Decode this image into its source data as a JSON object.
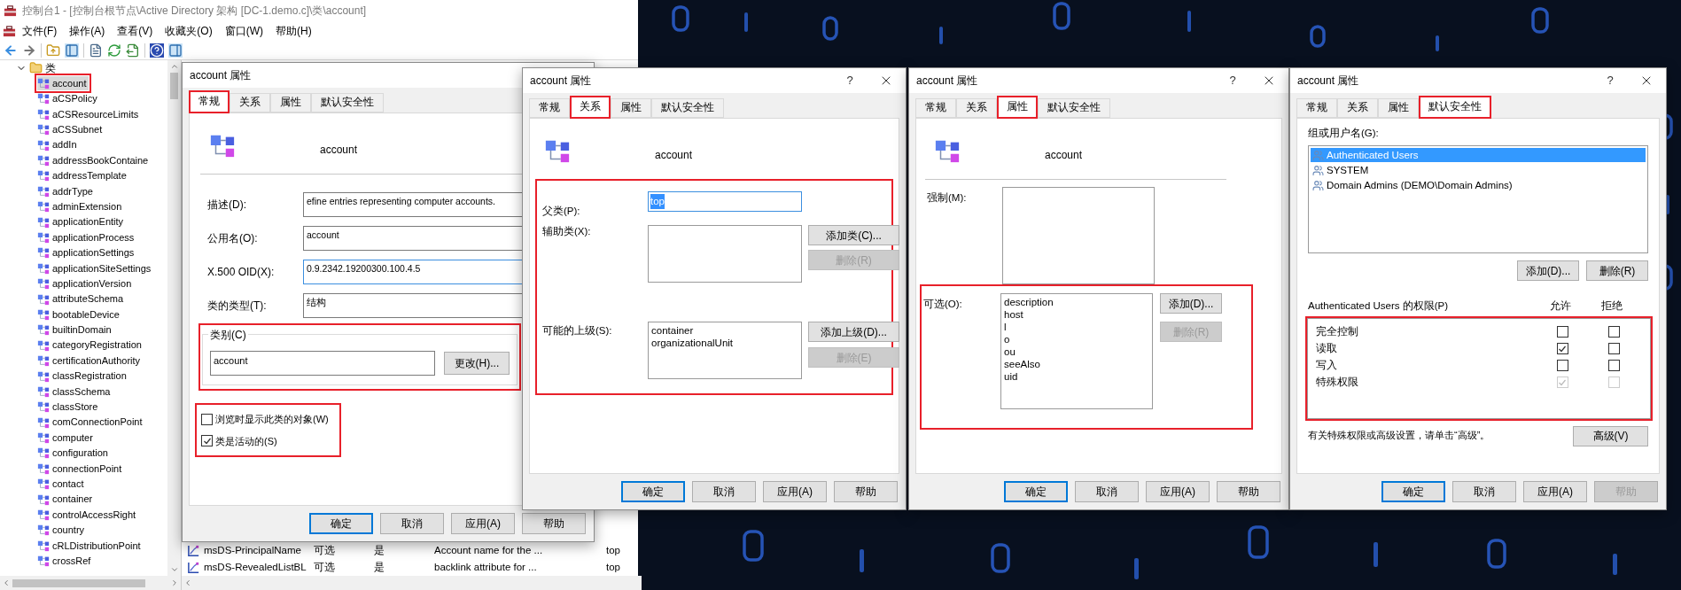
{
  "console": {
    "title": "控制台1 - [控制台根节点\\Active Directory 架构 [DC-1.demo.c]\\类\\account]",
    "menu": [
      "文件(F)",
      "操作(A)",
      "查看(V)",
      "收藏夹(O)",
      "窗口(W)",
      "帮助(H)"
    ],
    "tree": [
      {
        "label": "类",
        "expanded": true,
        "children": [
          {
            "label": "account",
            "selected": true,
            "highlighted": true
          },
          {
            "label": "aCSPolicy",
            "selected": false,
            "highlighted": false
          },
          {
            "label": "aCSResourceLimits",
            "selected": false,
            "highlighted": false
          },
          {
            "label": "aCSSubnet",
            "selected": false,
            "highlighted": false
          },
          {
            "label": "addIn",
            "selected": false,
            "highlighted": false
          },
          {
            "label": "addressBookContaine",
            "selected": false,
            "highlighted": false
          },
          {
            "label": "addressTemplate",
            "selected": false,
            "highlighted": false
          },
          {
            "label": "addrType",
            "selected": false,
            "highlighted": false
          },
          {
            "label": "adminExtension",
            "selected": false,
            "highlighted": false
          },
          {
            "label": "applicationEntity",
            "selected": false,
            "highlighted": false
          },
          {
            "label": "applicationProcess",
            "selected": false,
            "highlighted": false
          },
          {
            "label": "applicationSettings",
            "selected": false,
            "highlighted": false
          },
          {
            "label": "applicationSiteSettings",
            "selected": false,
            "highlighted": false
          },
          {
            "label": "applicationVersion",
            "selected": false,
            "highlighted": false
          },
          {
            "label": "attributeSchema",
            "selected": false,
            "highlighted": false
          },
          {
            "label": "bootableDevice",
            "selected": false,
            "highlighted": false
          },
          {
            "label": "builtinDomain",
            "selected": false,
            "highlighted": false
          },
          {
            "label": "categoryRegistration",
            "selected": false,
            "highlighted": false
          },
          {
            "label": "certificationAuthority",
            "selected": false,
            "highlighted": false
          },
          {
            "label": "classRegistration",
            "selected": false,
            "highlighted": false
          },
          {
            "label": "classSchema",
            "selected": false,
            "highlighted": false
          },
          {
            "label": "classStore",
            "selected": false,
            "highlighted": false
          },
          {
            "label": "comConnectionPoint",
            "selected": false,
            "highlighted": false
          },
          {
            "label": "computer",
            "selected": false,
            "highlighted": false
          },
          {
            "label": "configuration",
            "selected": false,
            "highlighted": false
          },
          {
            "label": "connectionPoint",
            "selected": false,
            "highlighted": false
          },
          {
            "label": "contact",
            "selected": false,
            "highlighted": false
          },
          {
            "label": "container",
            "selected": false,
            "highlighted": false
          },
          {
            "label": "controlAccessRight",
            "selected": false,
            "highlighted": false
          },
          {
            "label": "country",
            "selected": false,
            "highlighted": false
          },
          {
            "label": "cRLDistributionPoint",
            "selected": false,
            "highlighted": false
          },
          {
            "label": "crossRef",
            "selected": false,
            "highlighted": false
          }
        ]
      }
    ],
    "list_rows": [
      {
        "cells": [
          "msDS-PrincipalName",
          "可选",
          "是",
          "Account name for the ...",
          "top"
        ]
      },
      {
        "cells": [
          "msDS-RevealedListBL",
          "可选",
          "是",
          "backlink attribute for ...",
          "top"
        ]
      }
    ]
  },
  "dialogs": [
    {
      "kind": "general",
      "title": "account 属性",
      "tabs": [
        {
          "label": "常规",
          "selected": true,
          "highlighted": true
        },
        {
          "label": "关系",
          "selected": false,
          "highlighted": false
        },
        {
          "label": "属性",
          "selected": false,
          "highlighted": false
        },
        {
          "label": "默认安全性",
          "selected": false,
          "highlighted": false
        }
      ],
      "heading": "account",
      "fields": [
        {
          "label": "描述(D):",
          "value": "efine entries representing computer accounts.",
          "focused": false
        },
        {
          "label": "公用名(O):",
          "value": "account",
          "focused": false
        },
        {
          "label": "X.500 OID(X):",
          "value": "0.9.2342.19200300.100.4.5",
          "focused": true
        },
        {
          "label": "类的类型(T):",
          "value": "结构",
          "focused": false
        }
      ],
      "category": {
        "legend": "类别(C)",
        "value": "account",
        "button": "更改(H)...",
        "highlighted": true
      },
      "options": {
        "highlighted": true,
        "items": [
          {
            "label": "浏览时显示此类的对象(W)",
            "checked": false
          },
          {
            "label": "类是活动的(S)",
            "checked": true
          }
        ]
      },
      "buttons": [
        {
          "label": "确定",
          "default": true,
          "disabled": false
        },
        {
          "label": "取消",
          "default": false,
          "disabled": false
        },
        {
          "label": "应用(A)",
          "default": false,
          "disabled": false
        },
        {
          "label": "帮助",
          "default": false,
          "disabled": false
        }
      ]
    },
    {
      "kind": "relationship",
      "title": "account 属性",
      "help_button": "?",
      "closable": true,
      "tabs": [
        {
          "label": "常规",
          "selected": false,
          "highlighted": false
        },
        {
          "label": "关系",
          "selected": true,
          "highlighted": true
        },
        {
          "label": "属性",
          "selected": false,
          "highlighted": false
        },
        {
          "label": "默认安全性",
          "selected": false,
          "highlighted": false
        }
      ],
      "heading": "account",
      "highlighted": true,
      "parent": {
        "label": "父类(P):",
        "value": "top",
        "focused": true,
        "text_selected": true
      },
      "auxiliary": {
        "label": "辅助类(X):",
        "buttons": [
          {
            "label": "添加类(C)...",
            "disabled": false
          },
          {
            "label": "删除(R)",
            "disabled": true
          }
        ]
      },
      "superiors": {
        "label": "可能的上级(S):",
        "items": [
          "container",
          "organizationalUnit"
        ],
        "buttons": [
          {
            "label": "添加上级(D)...",
            "disabled": false
          },
          {
            "label": "删除(E)",
            "disabled": true
          }
        ]
      },
      "buttons": [
        {
          "label": "确定",
          "default": true,
          "disabled": false
        },
        {
          "label": "取消",
          "default": false,
          "disabled": false
        },
        {
          "label": "应用(A)",
          "default": false,
          "disabled": false
        },
        {
          "label": "帮助",
          "default": false,
          "disabled": false
        }
      ]
    },
    {
      "kind": "attributes",
      "title": "account 属性",
      "help_button": "?",
      "closable": true,
      "tabs": [
        {
          "label": "常规",
          "selected": false,
          "highlighted": false
        },
        {
          "label": "关系",
          "selected": false,
          "highlighted": false
        },
        {
          "label": "属性",
          "selected": true,
          "highlighted": true
        },
        {
          "label": "默认安全性",
          "selected": false,
          "highlighted": false
        }
      ],
      "heading": "account",
      "mandatory": {
        "label": "强制(M):"
      },
      "optional": {
        "label": "可选(O):",
        "highlighted": true,
        "items": [
          "description",
          "host",
          "l",
          "o",
          "ou",
          "seeAlso",
          "uid"
        ],
        "buttons": [
          {
            "label": "添加(D)...",
            "disabled": false
          },
          {
            "label": "删除(R)",
            "disabled": true
          }
        ]
      },
      "buttons": [
        {
          "label": "确定",
          "default": true,
          "disabled": false
        },
        {
          "label": "取消",
          "default": false,
          "disabled": false
        },
        {
          "label": "应用(A)",
          "default": false,
          "disabled": false
        },
        {
          "label": "帮助",
          "default": false,
          "disabled": false
        }
      ]
    },
    {
      "kind": "security",
      "title": "account 属性",
      "help_button": "?",
      "closable": true,
      "tabs": [
        {
          "label": "常规",
          "selected": false,
          "highlighted": false
        },
        {
          "label": "关系",
          "selected": false,
          "highlighted": false
        },
        {
          "label": "属性",
          "selected": false,
          "highlighted": false
        },
        {
          "label": "默认安全性",
          "selected": true,
          "highlighted": true
        }
      ],
      "groups_label": "组或用户名(G):",
      "groups": [
        {
          "name": "Authenticated Users",
          "selected": true
        },
        {
          "name": "SYSTEM",
          "selected": false
        },
        {
          "name": "Domain Admins (DEMO\\Domain Admins)",
          "selected": false
        }
      ],
      "group_buttons": [
        {
          "label": "添加(D)...",
          "disabled": false
        },
        {
          "label": "删除(R)",
          "disabled": false
        }
      ],
      "permissions_label": "Authenticated Users 的权限(P)",
      "allow_header": "允许",
      "deny_header": "拒绝",
      "permissions_highlighted": true,
      "permissions": [
        {
          "name": "完全控制",
          "allow": {
            "checked": false,
            "disabled": false
          },
          "deny": {
            "checked": false,
            "disabled": false
          }
        },
        {
          "name": "读取",
          "allow": {
            "checked": true,
            "disabled": false
          },
          "deny": {
            "checked": false,
            "disabled": false
          }
        },
        {
          "name": "写入",
          "allow": {
            "checked": false,
            "disabled": false
          },
          "deny": {
            "checked": false,
            "disabled": false
          }
        },
        {
          "name": "特殊权限",
          "allow": {
            "checked": true,
            "disabled": true
          },
          "deny": {
            "checked": false,
            "disabled": true
          }
        }
      ],
      "note": "有关特殊权限或高级设置，请单击“高级”。",
      "advanced_button": "高级(V)",
      "buttons": [
        {
          "label": "确定",
          "default": true,
          "disabled": false
        },
        {
          "label": "取消",
          "default": false,
          "disabled": false
        },
        {
          "label": "应用(A)",
          "default": false,
          "disabled": false
        },
        {
          "label": "帮助",
          "default": false,
          "disabled": true
        }
      ]
    }
  ]
}
